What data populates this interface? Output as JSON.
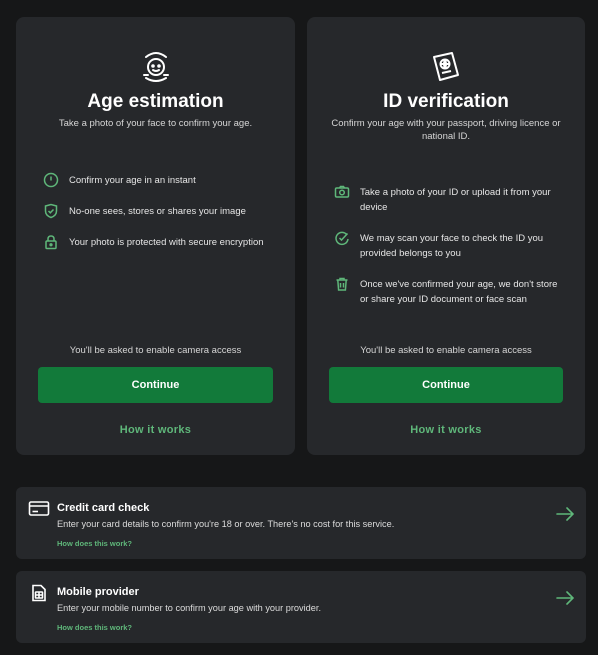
{
  "age_card": {
    "title": "Age estimation",
    "subtitle": "Take a photo of your face to confirm your age.",
    "features": [
      "Confirm your age in an instant",
      "No-one sees, stores or shares your image",
      "Your photo is protected with secure encryption"
    ],
    "note": "You'll be asked to enable camera access",
    "continue_label": "Continue",
    "how_label": "How it works"
  },
  "id_card": {
    "title": "ID verification",
    "subtitle": "Confirm your age with your passport, driving licence or national ID.",
    "features": [
      "Take a photo of your ID or upload it from your device",
      "We may scan your face to check the ID you provided belongs to you",
      "Once we've confirmed your age, we don't store or share your ID document or face scan"
    ],
    "note": "You'll be asked to enable camera access",
    "continue_label": "Continue",
    "how_label": "How it works"
  },
  "credit_card": {
    "title": "Credit card check",
    "description": "Enter your card details to confirm you're 18 or over. There's no cost for this service.",
    "link": "How does this work?"
  },
  "mobile": {
    "title": "Mobile provider",
    "description": "Enter your mobile number to confirm your age with your provider.",
    "link": "How does this work?"
  },
  "colors": {
    "accent": "#127a3a",
    "link": "#5fb77a",
    "card": "#26282b",
    "bg": "#161718"
  },
  "icons": {
    "age": "face-scan-icon",
    "id": "passport-icon",
    "clock": "clock-icon",
    "shield": "shield-check-icon",
    "lock": "lock-icon",
    "camera": "camera-icon",
    "face": "face-check-icon",
    "trash": "trash-icon",
    "card": "credit-card-icon",
    "sim": "sim-card-icon",
    "arrow": "arrow-right-icon"
  }
}
